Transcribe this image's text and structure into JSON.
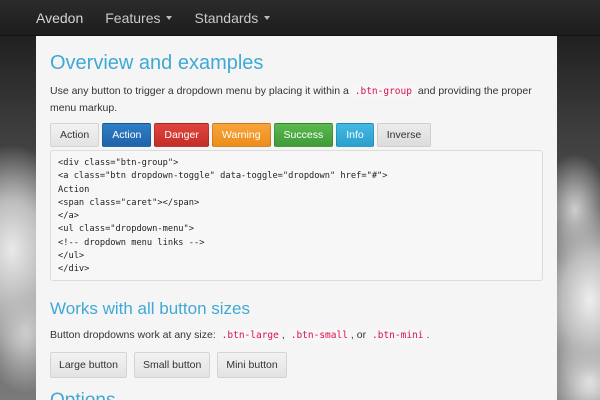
{
  "navbar": {
    "brand": "Avedon",
    "items": [
      {
        "label": "Features"
      },
      {
        "label": "Standards"
      }
    ]
  },
  "overview": {
    "heading": "Overview and examples",
    "lead_before": "Use any button to trigger a dropdown menu by placing it within a ",
    "lead_code": ".btn-group",
    "lead_after": " and providing the proper menu markup.",
    "buttons": [
      "Action",
      "Action",
      "Danger",
      "Warning",
      "Success",
      "Info",
      "Inverse"
    ],
    "code_lines": [
      "<div class=\"btn-group\">",
      "<a class=\"btn dropdown-toggle\" data-toggle=\"dropdown\" href=\"#\">",
      "Action",
      "<span class=\"caret\"></span>",
      "</a>",
      "<ul class=\"dropdown-menu\">",
      "<!-- dropdown menu links -->",
      "</ul>",
      "</div>"
    ]
  },
  "sizes": {
    "heading": "Works with all button sizes",
    "lead_before": "Button dropdowns work at any size: ",
    "code1": ".btn-large",
    "sep1": ", ",
    "code2": ".btn-small",
    "sep2": ", or ",
    "code3": ".btn-mini",
    "lead_after": ".",
    "buttons": [
      "Large button",
      "Small button",
      "Mini button"
    ]
  },
  "options": {
    "heading": "Options"
  }
}
